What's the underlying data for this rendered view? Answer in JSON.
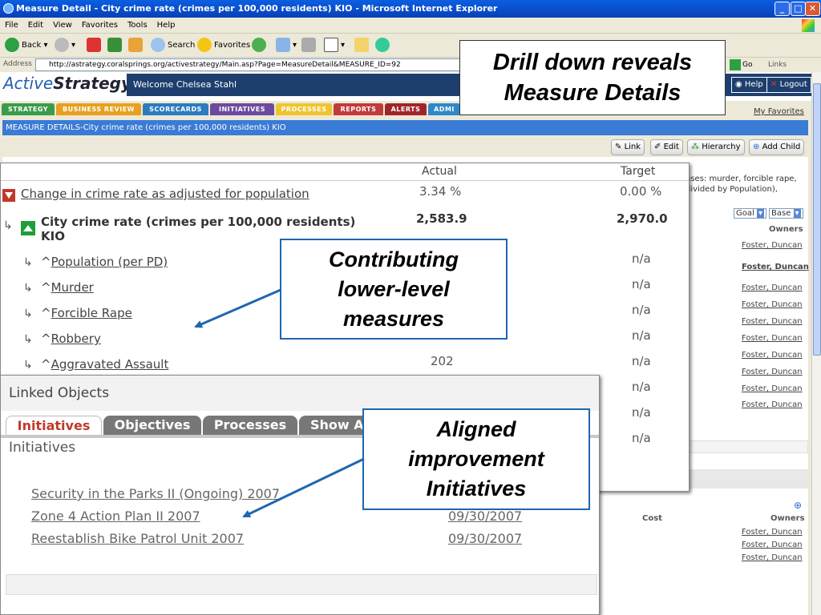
{
  "window": {
    "title": "Measure Detail - City crime rate (crimes per 100,000 residents) KIO - Microsoft Internet Explorer",
    "menu": [
      "File",
      "Edit",
      "View",
      "Favorites",
      "Tools",
      "Help"
    ],
    "toolbar": {
      "back": "Back",
      "search": "Search",
      "favorites": "Favorites"
    },
    "address_label": "Address",
    "address_url": "http://astrategy.coralsprings.org/activestrategy/Main.asp?Page=MeasureDetail&MEASURE_ID=92",
    "go": "Go",
    "links": "Links"
  },
  "app": {
    "logo_a": "Active",
    "logo_b": "Strategy",
    "welcome": "Welcome Chelsea Stahl",
    "help": "Help",
    "logout": "Logout",
    "nav_tabs": [
      "STRATEGY",
      "BUSINESS REVIEW",
      "SCORECARDS",
      "INITIATIVES",
      "PROCESSES",
      "REPORTS",
      "ALERTS",
      "ADMI"
    ],
    "my_favorites": "My Favorites",
    "page_header": "MEASURE DETAILS-City crime rate (crimes per 100,000 residents) KIO",
    "actions": [
      "Link",
      "Edit",
      "Hierarchy",
      "Add Child"
    ],
    "bg_text_1": "nses: murder, forcible rape,",
    "bg_text_2": "divided by Population),",
    "goal_select": "Goal",
    "base_select": "Base",
    "owners_header": "Owners",
    "cost_header": "Cost",
    "owners": [
      "Foster, Duncan",
      "Foster, Duncan",
      "Foster, Duncan",
      "Foster, Duncan",
      "Foster, Duncan",
      "Foster, Duncan",
      "Foster, Duncan",
      "Foster, Duncan",
      "Foster, Duncan",
      "Foster, Duncan"
    ],
    "owners_lower": [
      "Foster, Duncan",
      "Foster, Duncan",
      "Foster, Duncan"
    ]
  },
  "measures": {
    "headers": {
      "actual": "Actual",
      "target": "Target"
    },
    "rows": [
      {
        "name": "Change in crime rate as adjusted for population",
        "actual": "3.34 %",
        "target": "0.00 %"
      },
      {
        "name": "City crime rate (crimes per 100,000 residents)",
        "name2": "KIO",
        "actual": "2,583.9",
        "target": "2,970.0"
      },
      {
        "name": "Population (per PD)",
        "actual": "",
        "target": "n/a"
      },
      {
        "name": "Murder",
        "actual": "",
        "target": "n/a"
      },
      {
        "name": "Forcible Rape",
        "actual": "",
        "target": "n/a"
      },
      {
        "name": "Robbery",
        "actual": "",
        "target": "n/a"
      },
      {
        "name": "Aggravated Assault",
        "actual": "202",
        "target": "n/a"
      }
    ],
    "extra_targets": [
      "n/a",
      "n/a",
      "n/a"
    ],
    "caret": "^"
  },
  "linked": {
    "title": "Linked Objects",
    "tabs": [
      "Initiatives",
      "Objectives",
      "Processes",
      "Show A"
    ],
    "subtitle": "Initiatives",
    "initiatives": [
      {
        "name": "Security in the Parks II (Ongoing) 2007",
        "date": ""
      },
      {
        "name": "Zone 4 Action Plan II 2007",
        "date": "09/30/2007"
      },
      {
        "name": "Reestablish Bike Patrol Unit 2007",
        "date": "09/30/2007"
      }
    ]
  },
  "callouts": {
    "drill": [
      "Drill down reveals",
      "Measure Details"
    ],
    "contrib": [
      "Contributing",
      "lower-level",
      "measures"
    ],
    "aligned": [
      "Aligned",
      "improvement",
      "Initiatives"
    ]
  },
  "colors": {
    "callout_border": "#1f66b0",
    "page_header": "#3a7bd5",
    "status_red": "#c0392b",
    "status_green": "#1e9e3a"
  }
}
